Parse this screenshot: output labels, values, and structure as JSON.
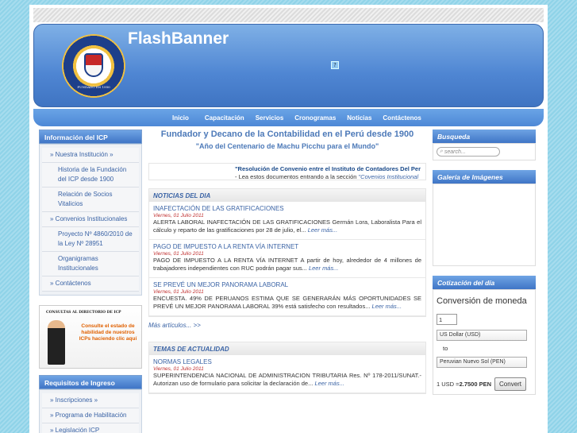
{
  "banner": {
    "title": "FlashBanner",
    "logo_text": "FUNDADO EN 1950",
    "flash_icon": "?"
  },
  "nav": [
    "Inicio",
    "Capacitación",
    "Servicios",
    "Cronogramas",
    "Noticias",
    "Contáctenos"
  ],
  "left": {
    "info_head": "Información del ICP",
    "items": [
      {
        "label": "» Nuestra Institución »",
        "sub": false
      },
      {
        "label": "Historia de la Fundación del ICP desde 1900",
        "sub": true
      },
      {
        "label": "Relación de Socios Vitalicios",
        "sub": true
      },
      {
        "label": "» Convenios Institucionales",
        "sub": false
      },
      {
        "label": "Proyecto Nº 4860/2010 de la Ley Nº 28951",
        "sub": true
      },
      {
        "label": "Organigramas Institucionales",
        "sub": true
      },
      {
        "label": "» Contáctenos",
        "sub": false
      }
    ],
    "promo_top": "CONSULTAS AL DIRECTORIO DE ICP",
    "promo_text": "Consulte el estado de habilidad de nuestros ICPs haciendo clic aquí",
    "req_head": "Requisitos de Ingreso",
    "req_items": [
      "» Inscripciones »",
      "» Programa de Habilitación",
      "» Legislación ICP"
    ]
  },
  "center": {
    "title": "Fundador y Decano de la Contabilidad en el Perú desde 1900",
    "subtitle": "\"Año del Centenario de Machu Picchu para el Mundo\"",
    "marquee_line1": "\"Resolución de Convenio entre el Instituto de Contadores Del Per",
    "marquee_line2": "- Lea estos documentos entrando a la sección ",
    "marquee_link": "\"Covenios Institucional",
    "news_head": "NOTICIAS DEL DIA",
    "news": [
      {
        "title": "INAFECTACIÓN DE LAS GRATIFICACIONES",
        "date": "Viernes, 01 Julio 2011",
        "body": "ALERTA LABORAL INAFECTACIÓN DE LAS GRATIFICACIONES Germán Lora, Laboralista Para el cálculo y reparto de las gratificaciones por 28 de julio, el...",
        "more": "Leer más..."
      },
      {
        "title": "PAGO DE IMPUESTO A LA RENTA VÍA INTERNET",
        "date": "Viernes, 01 Julio 2011",
        "body": "PAGO DE IMPUESTO A LA RENTA VÍA INTERNET A partir de hoy, alrededor de 4 millones de trabajadores independientes con RUC podrán pagar sus...",
        "more": "Leer más..."
      },
      {
        "title": "SE PREVÉ UN MEJOR PANORAMA LABORAL",
        "date": "Viernes, 01 Julio 2011",
        "body": "ENCUESTA. 49% DE PERUANOS ESTIMA QUE SE GENERARÁN MÁS OPORTUNIDADES SE PREVÉ UN MEJOR PANORAMA LABORAL  39% está satisfecho con resultados...",
        "more": "Leer más..."
      }
    ],
    "more_articles": "Más artículos...  >>",
    "topics_head": "TEMAS DE ACTUALIDAD",
    "topics": [
      {
        "title": "NORMAS LEGALES",
        "date": "Viernes, 01 Julio 2011",
        "body": "SUPERINTENDENCIA NACIONAL DE ADMINISTRACION TRIBUTARIA Res. Nº 178-2011/SUNAT.- Autorizan uso de formulario para solicitar la declaración de...",
        "more": "Leer más..."
      }
    ]
  },
  "right": {
    "search_head": "Busqueda",
    "search_placeholder": "search...",
    "gallery_head": "Galería de Imágenes",
    "currency_head": "Cotización del día",
    "conv_title": "Conversión de moneda",
    "amount": "1",
    "from": "US Dollar (USD)",
    "to_label": "to",
    "to": "Peruvian Nuevo Sol (PEN)",
    "result_prefix": "1 USD = ",
    "result_value": "2.7500 PEN",
    "convert_label": "Convert"
  }
}
